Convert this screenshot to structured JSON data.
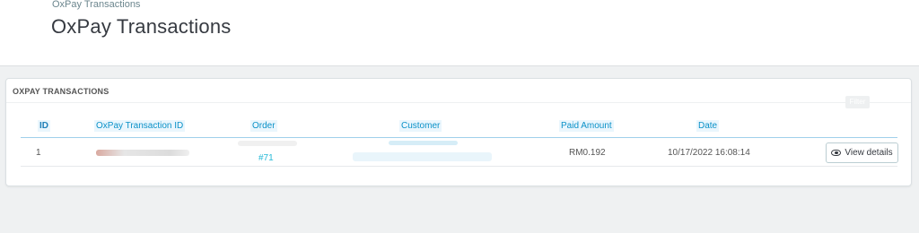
{
  "header": {
    "breadcrumb": "OxPay Transactions",
    "title": "OxPay Transactions"
  },
  "panel": {
    "title": "OXPAY TRANSACTIONS",
    "filter_button_label": "Filter"
  },
  "table": {
    "columns": [
      "ID",
      "OxPay Transaction ID",
      "Order",
      "Customer",
      "Paid Amount",
      "Date"
    ],
    "rows": [
      {
        "id": "1",
        "order_link": "#71",
        "paid_amount": "RM0.192",
        "date": "10/17/2022 16:08:14",
        "action_label": "View details"
      }
    ]
  },
  "colors": {
    "accent": "#25b9d7",
    "header_border": "#a0d0eb",
    "text": "#555555"
  }
}
